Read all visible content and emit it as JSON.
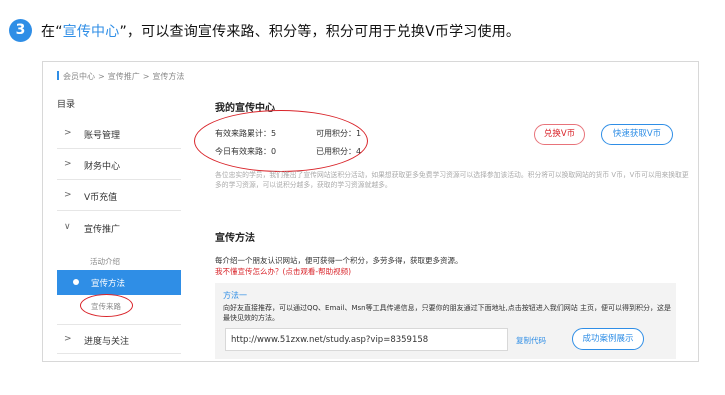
{
  "step": {
    "number": "3",
    "prefix": "在“",
    "highlight": "宣传中心",
    "suffix": "”，可以查询宣传来路、积分等，积分可用于兑换V币学习使用。"
  },
  "breadcrumb": [
    "会员中心",
    "宣传推广",
    "宣传方法"
  ],
  "breadcrumb_sep": ">",
  "sidebar": {
    "title": "目录",
    "items": [
      {
        "arrow": ">",
        "label": "账号管理"
      },
      {
        "arrow": ">",
        "label": "财务中心"
      },
      {
        "arrow": ">",
        "label": "V币充值"
      },
      {
        "arrow": "∨",
        "label": "宣传推广"
      },
      {
        "arrow": ">",
        "label": "进度与关注"
      }
    ],
    "sub_items": [
      "活动介绍",
      "宣传方法",
      "宣传来路"
    ],
    "active_sub": "宣传方法"
  },
  "center": {
    "title": "我的宣传中心",
    "stats": {
      "effective_total": "有效来路累计：5",
      "available_points": "可用积分：1",
      "today_effective": "今日有效来路：0",
      "used_points": "已用积分：4"
    },
    "redeem_button": "兑换V币",
    "get_vcoin_button": "快速获取V币",
    "description": "各位忠实的学员，我们推出了宣传网站送积分活动，如果想获取更多免费学习资源可以选择参加该活动。积分将可以换取网站的货币 V币，V币可以用来换取更多的学习资源，可以说积分越多，获取的学习资源就越多。"
  },
  "methods": {
    "title": "宣传方法",
    "description": "每介绍一个朋友认识网站，便可获得一个积分，多劳多得，获取更多资源。",
    "help_link": "我不懂宣传怎么办？(点击观看-帮助视频)",
    "method1": {
      "title": "方法一",
      "description": "向好友直接推荐，可以通过QQ、Email、Msn等工具传递信息，只要你的朋友通过下面地址,点击按钮进入我们网站 主页，便可以得到积分，这是最快见效的方法。",
      "url": "http://www.51zxw.net/study.asp?vip=8359158",
      "copy_label": "复制代码",
      "cases_button": "成功案例展示"
    }
  },
  "colors": {
    "accent": "#2f8ee6",
    "highlight_red": "#d9242a"
  }
}
